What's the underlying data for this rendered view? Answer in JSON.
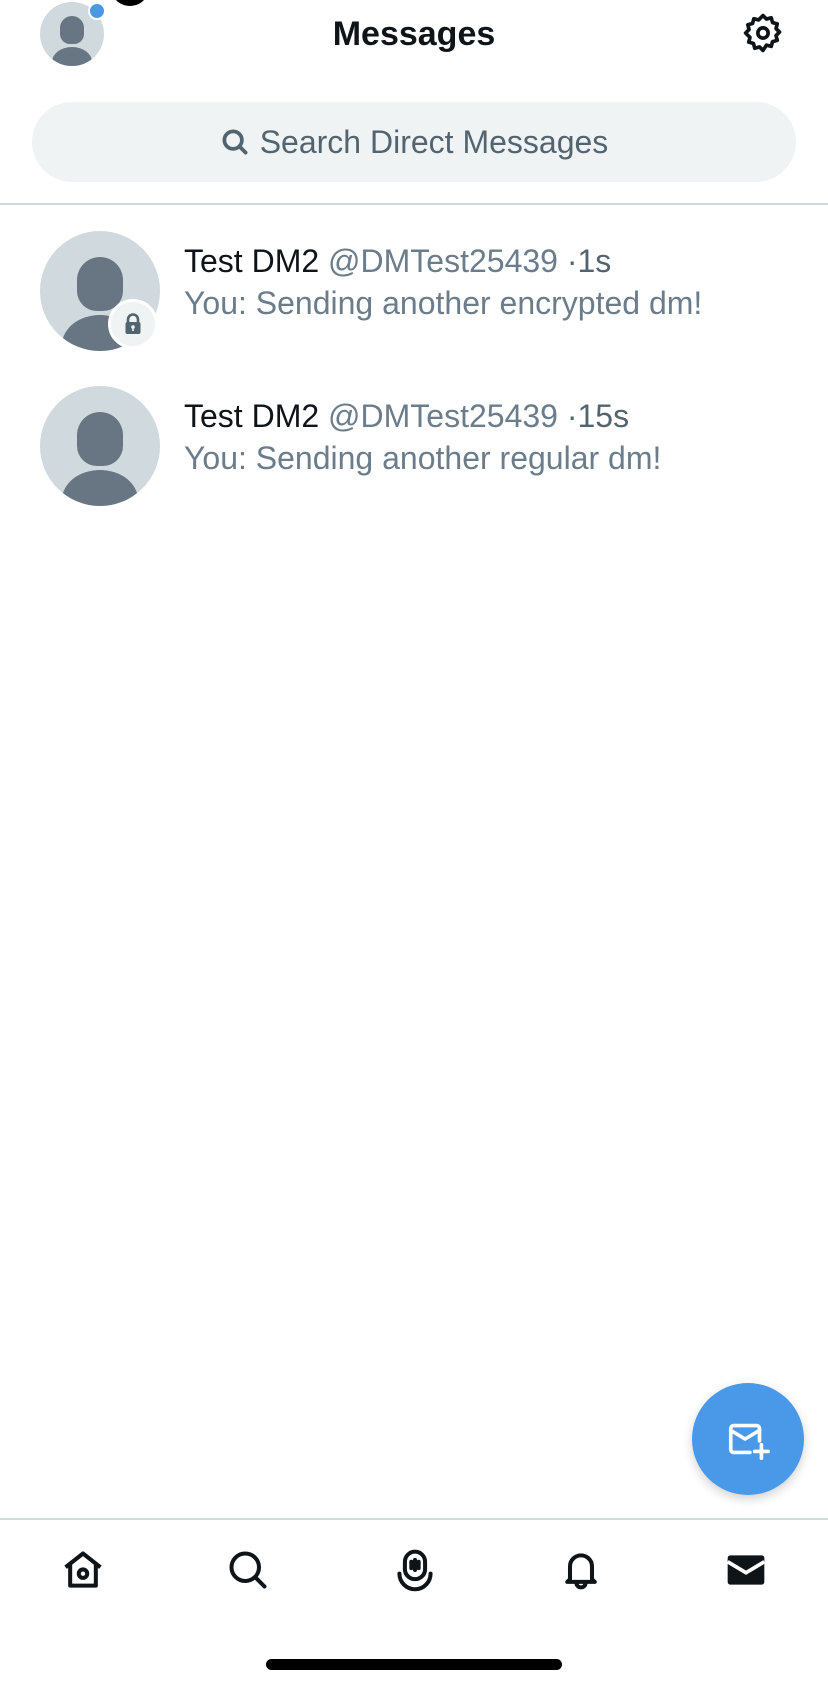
{
  "header": {
    "title": "Messages",
    "avatar_icon": "default-avatar-icon",
    "notification_dot": true,
    "settings_icon": "gear-icon"
  },
  "search": {
    "placeholder": "Search Direct Messages",
    "icon": "search-icon"
  },
  "conversations": [
    {
      "name": "Test DM2",
      "handle": "@DMTest25439",
      "separator": "·",
      "time": "1s",
      "preview": "You: Sending another encrypted dm!",
      "encrypted": true,
      "badge_icon": "lock-icon"
    },
    {
      "name": "Test DM2",
      "handle": "@DMTest25439",
      "separator": "·",
      "time": "15s",
      "preview": "You: Sending another regular dm!",
      "encrypted": false
    }
  ],
  "fab": {
    "icon": "new-message-icon",
    "color": "#4a99e9"
  },
  "bottom_nav": {
    "items": [
      {
        "id": "home",
        "icon": "home-icon"
      },
      {
        "id": "search",
        "icon": "search-icon"
      },
      {
        "id": "spaces",
        "icon": "spaces-icon"
      },
      {
        "id": "notifications",
        "icon": "bell-icon"
      },
      {
        "id": "messages",
        "icon": "mail-icon",
        "active": true
      }
    ]
  },
  "colors": {
    "text_primary": "#0f1419",
    "text_secondary": "#536471",
    "accent": "#4a99e9",
    "avatar_bg": "#cfd9de",
    "avatar_fg": "#687684",
    "search_bg": "#eff3f4"
  }
}
